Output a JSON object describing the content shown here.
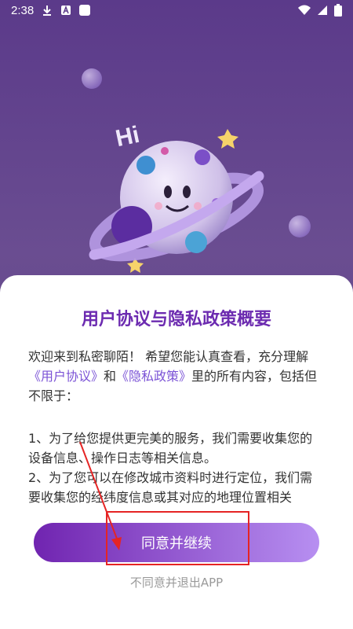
{
  "status_bar": {
    "time": "2:38",
    "icons": [
      "download-icon",
      "a-icon",
      "app-icon",
      "wifi-icon",
      "signal-icon",
      "battery-icon"
    ]
  },
  "illustration": {
    "hi_text": "Hi"
  },
  "dialog": {
    "title": "用户协议与隐私政策概要",
    "intro_1": "欢迎来到私密聊陌！ 希望您能认真查看，充分理解",
    "user_agreement": "《用户协议》",
    "and": "和",
    "privacy_policy": "《隐私政策》",
    "intro_2": "里的所有内容，包括但不限于：",
    "item_1": "1、为了给您提供更完美的服务，我们需要收集您的设备信息、操作日志等相关信息。",
    "item_2": "2、为了您可以在修改城市资料时进行定位，我们需要收集您的经纬度信息或其对应的地理位置相关",
    "agree_button": "同意并继续",
    "disagree_link": "不同意并退出APP"
  },
  "colors": {
    "accent": "#6c2bb0",
    "link": "#7b53d6",
    "button_start": "#7024b0",
    "button_end": "#b78ff1",
    "annotation": "#e52424"
  }
}
